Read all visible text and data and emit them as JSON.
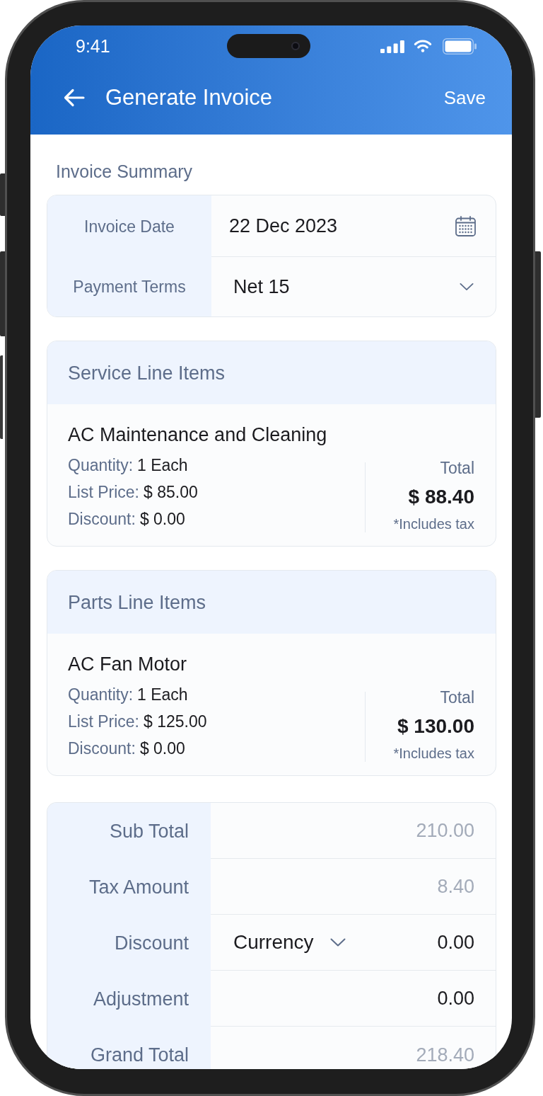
{
  "status_bar": {
    "time": "9:41"
  },
  "header": {
    "title": "Generate Invoice",
    "action": "Save"
  },
  "invoice_summary": {
    "title": "Invoice Summary",
    "fields": [
      {
        "kind": "date",
        "label": "Invoice Date",
        "value": "22 Dec 2023"
      },
      {
        "kind": "select",
        "label": "Payment Terms",
        "value": "Net 15"
      }
    ]
  },
  "line_item_sections": [
    {
      "title": "Service Line Items",
      "items": [
        {
          "name": "AC Maintenance and Cleaning",
          "details": [
            {
              "label": "Quantity:",
              "value": "1 Each"
            },
            {
              "label": "List Price:",
              "value": "$ 85.00"
            },
            {
              "label": "Discount:",
              "value": "$ 0.00"
            }
          ],
          "total_label": "Total",
          "total": "$ 88.40",
          "note": "*Includes tax"
        }
      ]
    },
    {
      "title": "Parts Line Items",
      "items": [
        {
          "name": "AC Fan Motor",
          "details": [
            {
              "label": "Quantity:",
              "value": "1 Each"
            },
            {
              "label": "List Price:",
              "value": "$ 125.00"
            },
            {
              "label": "Discount:",
              "value": "$ 0.00"
            }
          ],
          "total_label": "Total",
          "total": "$ 130.00",
          "note": "*Includes tax"
        }
      ]
    }
  ],
  "totals": [
    {
      "kind": "amount",
      "label": "Sub Total",
      "value": "210.00",
      "disabled": true
    },
    {
      "kind": "amount",
      "label": "Tax Amount",
      "value": "8.40",
      "disabled": true
    },
    {
      "kind": "amount_with_unit",
      "label": "Discount",
      "unit": "Currency",
      "value": "0.00",
      "disabled": false
    },
    {
      "kind": "amount",
      "label": "Adjustment",
      "value": "0.00",
      "disabled": false
    },
    {
      "kind": "amount",
      "label": "Grand Total",
      "value": "218.40",
      "disabled": true
    }
  ]
}
